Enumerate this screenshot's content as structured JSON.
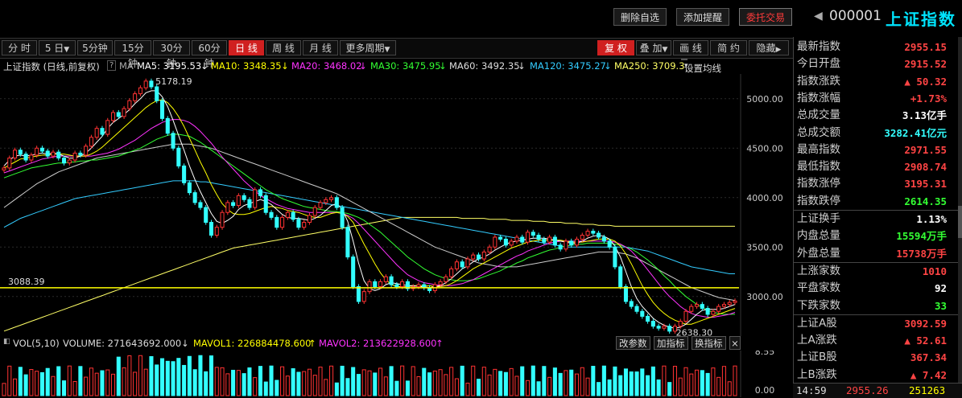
{
  "toolbar": {
    "delete_watch": "删除自选",
    "add_alert": "添加提醒",
    "trade": "委托交易",
    "code": "000001",
    "name": "上证指数"
  },
  "periods": [
    "分 时",
    "5 日",
    "5分钟",
    "15分钟",
    "30分钟",
    "60分钟",
    "日 线",
    "周 线",
    "月 线",
    "更多周期"
  ],
  "active_period": "日 线",
  "chart_tools": [
    "复 权",
    "叠 加",
    "画 线",
    "简 约",
    "隐藏"
  ],
  "ma_bar": {
    "title": "上证指数 (日线,前复权)",
    "help": "?",
    "ma_label": "MA",
    "ma5": "MA5: 3195.53",
    "ma10": "MA10: 3348.35",
    "ma20": "MA20: 3468.02",
    "ma30": "MA30: 3475.95",
    "ma60": "MA60: 3492.35",
    "ma120": "MA120: 3475.27",
    "ma250": "MA250: 3709.3",
    "settings": "设置均线"
  },
  "colors": {
    "ma5": "#ffffff",
    "ma10": "#ffff00",
    "ma20": "#ff33ff",
    "ma30": "#33ff33",
    "ma60": "#cccccc",
    "ma120": "#33ccff",
    "ma250": "#ffff66",
    "up": "#ff3333",
    "down": "#33ffff",
    "ref_line": "#ffff00"
  },
  "chart_data": {
    "type": "candlestick",
    "y_ticks": [
      "5000.00",
      "4500.00",
      "4000.00",
      "3500.00",
      "3000.00"
    ],
    "ylim": [
      2600,
      5250
    ],
    "high_label": "5178.19",
    "low_label": "2638.30",
    "ref_line_label": "3088.39",
    "ref_line_value": 3088.39,
    "close_series": [
      4300,
      4400,
      4480,
      4440,
      4380,
      4430,
      4500,
      4470,
      4420,
      4460,
      4400,
      4350,
      4380,
      4450,
      4430,
      4520,
      4610,
      4700,
      4640,
      4780,
      4860,
      4820,
      4900,
      4980,
      5050,
      5110,
      5178,
      5120,
      4980,
      4800,
      4650,
      4500,
      4320,
      4150,
      4050,
      3950,
      3900,
      3750,
      3620,
      3700,
      3850,
      3950,
      3920,
      4020,
      3980,
      3900,
      4080,
      4020,
      3850,
      3800,
      3700,
      3800,
      3850,
      3780,
      3700,
      3750,
      3820,
      3900,
      3950,
      3980,
      4000,
      3900,
      3700,
      3400,
      3100,
      2950,
      3050,
      3150,
      3100,
      3150,
      3200,
      3120,
      3100,
      3150,
      3080,
      3100,
      3120,
      3090,
      3060,
      3120,
      3150,
      3200,
      3280,
      3350,
      3300,
      3380,
      3420,
      3380,
      3450,
      3500,
      3600,
      3580,
      3520,
      3560,
      3600,
      3550,
      3650,
      3620,
      3580,
      3550,
      3600,
      3520,
      3480,
      3560,
      3520,
      3580,
      3620,
      3660,
      3640,
      3600,
      3560,
      3500,
      3300,
      3100,
      2950,
      2900,
      2850,
      2800,
      2750,
      2700,
      2680,
      2700,
      2650,
      2700,
      2750,
      2850,
      2900,
      2920,
      2880,
      2820,
      2850,
      2900,
      2920,
      2940,
      2955
    ],
    "ma5_series": [
      4320,
      4380,
      4420,
      4430,
      4420,
      4430,
      4440,
      4450,
      4440,
      4450,
      4440,
      4420,
      4400,
      4400,
      4420,
      4450,
      4500,
      4560,
      4620,
      4700,
      4760,
      4800,
      4840,
      4890,
      4950,
      5000,
      5060,
      5080,
      5080,
      5020,
      4920,
      4780,
      4630,
      4480,
      4320,
      4180,
      4060,
      3950,
      3840,
      3760,
      3740,
      3770,
      3810,
      3880,
      3920,
      3940,
      3960,
      3980,
      3960,
      3930,
      3880,
      3830,
      3800,
      3790,
      3790,
      3780,
      3770,
      3790,
      3820,
      3870,
      3920,
      3940,
      3880,
      3760,
      3560,
      3340,
      3160,
      3080,
      3060,
      3080,
      3120,
      3140,
      3130,
      3120,
      3110,
      3110,
      3100,
      3100,
      3090,
      3100,
      3110,
      3140,
      3180,
      3230,
      3280,
      3310,
      3350,
      3380,
      3400,
      3430,
      3470,
      3500,
      3530,
      3550,
      3560,
      3570,
      3580,
      3590,
      3590,
      3590,
      3580,
      3570,
      3560,
      3550,
      3540,
      3540,
      3560,
      3590,
      3610,
      3620,
      3610,
      3580,
      3510,
      3400,
      3250,
      3100,
      2980,
      2900,
      2840,
      2780,
      2740,
      2710,
      2690,
      2680,
      2690,
      2720,
      2770,
      2820,
      2860,
      2870,
      2870,
      2870,
      2880,
      2900,
      2920
    ],
    "ma10_series": [
      4300,
      4330,
      4360,
      4390,
      4400,
      4410,
      4420,
      4430,
      4430,
      4440,
      4440,
      4440,
      4430,
      4420,
      4420,
      4420,
      4440,
      4470,
      4510,
      4560,
      4610,
      4660,
      4710,
      4760,
      4810,
      4860,
      4910,
      4950,
      4980,
      4990,
      4960,
      4900,
      4820,
      4720,
      4600,
      4480,
      4360,
      4250,
      4130,
      4030,
      3940,
      3880,
      3840,
      3830,
      3830,
      3840,
      3860,
      3880,
      3900,
      3910,
      3900,
      3890,
      3870,
      3860,
      3850,
      3830,
      3810,
      3800,
      3800,
      3820,
      3840,
      3850,
      3840,
      3810,
      3750,
      3640,
      3530,
      3430,
      3330,
      3240,
      3170,
      3120,
      3100,
      3100,
      3100,
      3110,
      3110,
      3110,
      3110,
      3100,
      3100,
      3110,
      3130,
      3160,
      3200,
      3240,
      3280,
      3310,
      3340,
      3370,
      3400,
      3430,
      3460,
      3490,
      3510,
      3530,
      3550,
      3560,
      3570,
      3570,
      3570,
      3570,
      3570,
      3560,
      3550,
      3550,
      3550,
      3560,
      3570,
      3580,
      3580,
      3580,
      3560,
      3510,
      3430,
      3330,
      3220,
      3110,
      3020,
      2940,
      2880,
      2830,
      2790,
      2760,
      2740,
      2720,
      2720,
      2740,
      2760,
      2780,
      2800,
      2820,
      2840,
      2860,
      2880
    ],
    "ma20_series": [
      4250,
      4270,
      4290,
      4310,
      4330,
      4350,
      4370,
      4390,
      4400,
      4410,
      4420,
      4420,
      4420,
      4420,
      4420,
      4420,
      4420,
      4430,
      4440,
      4450,
      4470,
      4490,
      4520,
      4550,
      4580,
      4620,
      4660,
      4700,
      4730,
      4760,
      4780,
      4790,
      4790,
      4780,
      4760,
      4720,
      4670,
      4610,
      4550,
      4480,
      4410,
      4350,
      4290,
      4230,
      4170,
      4120,
      4070,
      4020,
      3990,
      3960,
      3930,
      3910,
      3890,
      3880,
      3870,
      3860,
      3850,
      3850,
      3850,
      3850,
      3850,
      3850,
      3840,
      3820,
      3790,
      3740,
      3680,
      3620,
      3560,
      3500,
      3440,
      3380,
      3320,
      3270,
      3220,
      3190,
      3160,
      3140,
      3130,
      3120,
      3110,
      3110,
      3110,
      3120,
      3130,
      3150,
      3170,
      3200,
      3230,
      3260,
      3290,
      3320,
      3350,
      3380,
      3410,
      3430,
      3460,
      3480,
      3500,
      3520,
      3540,
      3550,
      3560,
      3560,
      3560,
      3560,
      3560,
      3560,
      3560,
      3560,
      3560,
      3560,
      3550,
      3530,
      3500,
      3460,
      3400,
      3340,
      3270,
      3200,
      3130,
      3060,
      3000,
      2950,
      2900,
      2860,
      2830,
      2810,
      2800,
      2790,
      2790,
      2800,
      2810,
      2820,
      2840
    ],
    "ma30_series": [
      4200,
      4220,
      4240,
      4260,
      4280,
      4300,
      4310,
      4320,
      4330,
      4340,
      4350,
      4350,
      4360,
      4360,
      4370,
      4370,
      4380,
      4380,
      4390,
      4400,
      4410,
      4420,
      4440,
      4460,
      4480,
      4500,
      4530,
      4560,
      4590,
      4610,
      4630,
      4640,
      4640,
      4630,
      4620,
      4590,
      4560,
      4520,
      4480,
      4440,
      4400,
      4360,
      4320,
      4280,
      4240,
      4200,
      4160,
      4120,
      4080,
      4050,
      4020,
      3990,
      3970,
      3950,
      3930,
      3910,
      3900,
      3890,
      3880,
      3870,
      3860,
      3860,
      3850,
      3840,
      3820,
      3800,
      3770,
      3730,
      3690,
      3650,
      3600,
      3550,
      3500,
      3450,
      3400,
      3360,
      3320,
      3280,
      3250,
      3220,
      3200,
      3180,
      3170,
      3160,
      3160,
      3160,
      3170,
      3180,
      3200,
      3220,
      3240,
      3260,
      3290,
      3310,
      3340,
      3360,
      3390,
      3410,
      3430,
      3450,
      3470,
      3480,
      3500,
      3510,
      3520,
      3530,
      3530,
      3540,
      3540,
      3540,
      3540,
      3540,
      3530,
      3520,
      3500,
      3480,
      3450,
      3410,
      3370,
      3320,
      3270,
      3210,
      3160,
      3100,
      3050,
      3000,
      2960,
      2920,
      2890,
      2860,
      2840,
      2830,
      2820,
      2820,
      2820
    ],
    "ma60_series": [
      3900,
      3940,
      3980,
      4020,
      4060,
      4100,
      4140,
      4170,
      4200,
      4230,
      4260,
      4280,
      4300,
      4320,
      4340,
      4360,
      4380,
      4400,
      4410,
      4420,
      4430,
      4440,
      4450,
      4460,
      4470,
      4480,
      4490,
      4500,
      4510,
      4520,
      4530,
      4540,
      4540,
      4540,
      4540,
      4530,
      4520,
      4510,
      4500,
      4480,
      4460,
      4440,
      4420,
      4400,
      4380,
      4360,
      4340,
      4320,
      4300,
      4280,
      4260,
      4240,
      4220,
      4200,
      4180,
      4160,
      4140,
      4120,
      4100,
      4080,
      4060,
      4040,
      4010,
      3980,
      3950,
      3920,
      3890,
      3860,
      3830,
      3800,
      3770,
      3740,
      3710,
      3680,
      3650,
      3620,
      3590,
      3560,
      3530,
      3500,
      3480,
      3460,
      3440,
      3420,
      3400,
      3380,
      3360,
      3340,
      3330,
      3320,
      3310,
      3300,
      3300,
      3300,
      3300,
      3310,
      3320,
      3330,
      3340,
      3350,
      3360,
      3370,
      3380,
      3390,
      3400,
      3410,
      3420,
      3430,
      3440,
      3450,
      3450,
      3450,
      3450,
      3440,
      3430,
      3410,
      3390,
      3360,
      3330,
      3300,
      3270,
      3240,
      3210,
      3180,
      3150,
      3120,
      3090,
      3070,
      3050,
      3030,
      3010,
      2990,
      2980,
      2970,
      2960
    ],
    "ma120_series": [
      3700,
      3730,
      3760,
      3790,
      3810,
      3830,
      3850,
      3870,
      3890,
      3910,
      3930,
      3950,
      3970,
      3990,
      4000,
      4010,
      4020,
      4030,
      4040,
      4050,
      4060,
      4070,
      4080,
      4090,
      4100,
      4110,
      4120,
      4130,
      4140,
      4150,
      4160,
      4170,
      4170,
      4170,
      4170,
      4170,
      4160,
      4160,
      4150,
      4140,
      4130,
      4120,
      4110,
      4100,
      4090,
      4080,
      4070,
      4060,
      4050,
      4040,
      4030,
      4020,
      4010,
      4000,
      3990,
      3980,
      3970,
      3960,
      3950,
      3940,
      3930,
      3920,
      3910,
      3900,
      3890,
      3880,
      3870,
      3860,
      3850,
      3840,
      3830,
      3820,
      3810,
      3800,
      3790,
      3780,
      3770,
      3760,
      3750,
      3740,
      3730,
      3720,
      3710,
      3700,
      3690,
      3680,
      3670,
      3660,
      3650,
      3640,
      3630,
      3620,
      3610,
      3600,
      3590,
      3580,
      3570,
      3560,
      3550,
      3540,
      3530,
      3520,
      3510,
      3500,
      3500,
      3500,
      3500,
      3500,
      3500,
      3500,
      3500,
      3500,
      3500,
      3500,
      3500,
      3490,
      3480,
      3470,
      3460,
      3440,
      3420,
      3400,
      3380,
      3360,
      3340,
      3320,
      3300,
      3290,
      3280,
      3270,
      3260,
      3250,
      3240,
      3230,
      3230
    ],
    "ma250_series": [
      2650,
      2670,
      2690,
      2710,
      2730,
      2750,
      2770,
      2790,
      2810,
      2830,
      2850,
      2870,
      2890,
      2910,
      2930,
      2950,
      2970,
      2990,
      3010,
      3030,
      3050,
      3070,
      3090,
      3110,
      3130,
      3150,
      3170,
      3190,
      3210,
      3230,
      3250,
      3270,
      3290,
      3310,
      3330,
      3350,
      3370,
      3390,
      3410,
      3430,
      3450,
      3470,
      3490,
      3500,
      3510,
      3520,
      3530,
      3540,
      3550,
      3560,
      3570,
      3580,
      3590,
      3600,
      3610,
      3620,
      3630,
      3640,
      3650,
      3660,
      3670,
      3680,
      3690,
      3700,
      3710,
      3720,
      3730,
      3740,
      3750,
      3760,
      3770,
      3780,
      3790,
      3800,
      3800,
      3800,
      3800,
      3800,
      3800,
      3800,
      3800,
      3800,
      3800,
      3800,
      3790,
      3790,
      3790,
      3790,
      3790,
      3780,
      3780,
      3780,
      3780,
      3770,
      3770,
      3770,
      3770,
      3760,
      3760,
      3760,
      3750,
      3750,
      3750,
      3740,
      3740,
      3740,
      3730,
      3730,
      3730,
      3720,
      3720,
      3720,
      3710,
      3710,
      3710,
      3710,
      3710,
      3710,
      3710,
      3710,
      3710,
      3710,
      3710,
      3710,
      3710,
      3710,
      3710,
      3710,
      3710,
      3710,
      3710,
      3710,
      3710,
      3710,
      3710
    ],
    "vol_ticks": [
      "8.55",
      "0.00"
    ]
  },
  "vol_bar": {
    "label": "VOL(5,10)",
    "volume": "VOLUME: 271643692.000",
    "mavol1": "MAVOL1: 226884478.600",
    "mavol2": "MAVOL2: 213622928.600",
    "btn_params": "改参数",
    "btn_add": "加指标",
    "btn_switch": "换指标"
  },
  "panel": {
    "rows": [
      {
        "label": "最新指数",
        "value": "2955.15",
        "color": "#ff4444"
      },
      {
        "label": "今日开盘",
        "value": "2915.52",
        "color": "#ff4444"
      },
      {
        "label": "指数涨跌",
        "value": "▲ 50.32",
        "color": "#ff4444"
      },
      {
        "label": "指数涨幅",
        "value": "+1.73%",
        "color": "#ff4444"
      },
      {
        "label": "总成交量",
        "value": "3.13亿手",
        "color": "#ffffff"
      },
      {
        "label": "总成交额",
        "value": "3282.41亿元",
        "color": "#33ffff"
      },
      {
        "label": "最高指数",
        "value": "2971.55",
        "color": "#ff4444"
      },
      {
        "label": "最低指数",
        "value": "2908.74",
        "color": "#ff4444"
      },
      {
        "label": "指数涨停",
        "value": "3195.31",
        "color": "#ff4444"
      },
      {
        "label": "指数跌停",
        "value": "2614.35",
        "color": "#33ff33"
      },
      {
        "label": "上证换手",
        "value": "1.13%",
        "color": "#ffffff"
      },
      {
        "label": "内盘总量",
        "value": "15594万手",
        "color": "#33ff33"
      },
      {
        "label": "外盘总量",
        "value": "15738万手",
        "color": "#ff4444"
      },
      {
        "label": "上涨家数",
        "value": "1010",
        "color": "#ff4444"
      },
      {
        "label": "平盘家数",
        "value": "92",
        "color": "#ffffff"
      },
      {
        "label": "下跌家数",
        "value": "33",
        "color": "#33ff33"
      },
      {
        "label": "上证A股",
        "value": "3092.59",
        "color": "#ff4444"
      },
      {
        "label": "上A涨跌",
        "value": "▲ 52.61",
        "color": "#ff4444"
      },
      {
        "label": "上证B股",
        "value": "367.34",
        "color": "#ff4444"
      },
      {
        "label": "上B涨跌",
        "value": "▲ 7.42",
        "color": "#ff4444"
      }
    ],
    "status_time": "14:59",
    "status_price": "2955.26",
    "status_vol": "251263"
  }
}
